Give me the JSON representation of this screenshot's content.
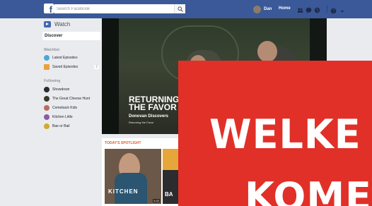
{
  "topbar": {
    "logo": "f",
    "search_placeholder": "Search Facebook",
    "user_name": "Dan",
    "home_label": "Home"
  },
  "sidebar": {
    "title": "Watch",
    "active_item": "Discover",
    "watchlist_label": "Watchlist",
    "watchlist_items": [
      {
        "label": "Latest Episodes",
        "badge": ""
      },
      {
        "label": "Saved Episodes",
        "badge": "2"
      }
    ],
    "following_label": "Following",
    "following_items": [
      {
        "label": "Showdown"
      },
      {
        "label": "The Great Cheese Hunt"
      },
      {
        "label": "Comeback Kids"
      },
      {
        "label": "Kitchen Little"
      },
      {
        "label": "Bae or Bail"
      }
    ]
  },
  "hero": {
    "title_line1": "RETURNING",
    "title_line2": "THE FAVOR",
    "subtitle": "Donovan Discovers",
    "meta": "Returning the Favor"
  },
  "spotlight": {
    "header": "TODAY'S SPOTLIGHT",
    "cards": [
      {
        "caption": "KITCHEN",
        "duration": "5:32"
      },
      {
        "caption": "BA"
      }
    ]
  },
  "overlay": {
    "line1": "WELKE",
    "line2": "KOME"
  },
  "colors": {
    "brand": "#3b5998",
    "overlay_red": "#e13028",
    "spotlight_orange": "#e95c1b"
  }
}
